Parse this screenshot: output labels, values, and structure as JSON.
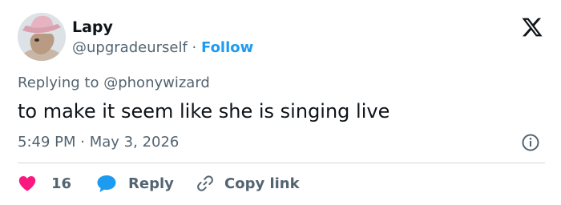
{
  "author": {
    "name": "Lapy",
    "handle": "@upgradeurself",
    "separator": "·",
    "follow_label": "Follow"
  },
  "reply_context": {
    "prefix": "Replying to",
    "mention": "@phonywizard"
  },
  "tweet": {
    "text": "to make it seem like she is singing live",
    "time": "5:49 PM",
    "separator": "·",
    "date": "May 3, 2026"
  },
  "actions": {
    "like_count": "16",
    "reply_label": "Reply",
    "copy_link_label": "Copy link"
  },
  "icons": {
    "brand": "x-logo-icon",
    "info": "info-icon",
    "like": "heart-icon",
    "reply": "reply-bubble-icon",
    "copy": "link-icon"
  },
  "colors": {
    "accent": "#1d9bf0",
    "like": "#f91880",
    "text": "#0f1419",
    "muted": "#536471",
    "divider": "#cfd9de"
  }
}
